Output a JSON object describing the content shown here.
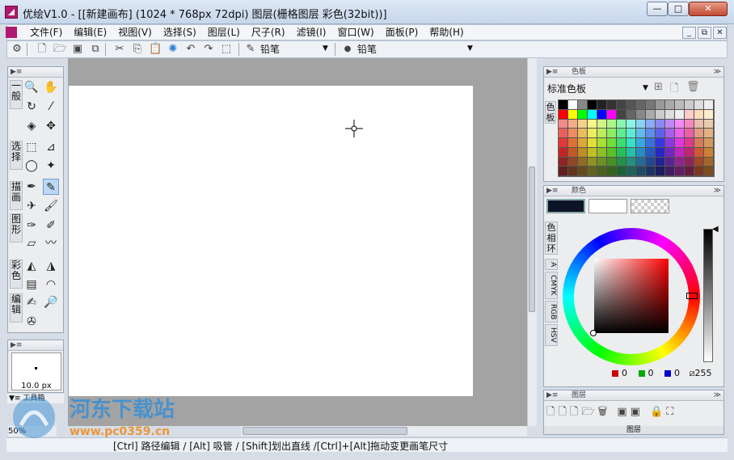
{
  "window": {
    "title": "优绘V1.0 - [[新建画布] (1024 * 768px 72dpi)    图层(栅格图层 彩色(32bit))]",
    "minimize": "—",
    "maximize": "□",
    "close": "✕"
  },
  "menu": [
    "文件(F)",
    "编辑(E)",
    "视图(V)",
    "选择(S)",
    "图层(L)",
    "尺子(R)",
    "滤镜(I)",
    "窗口(W)",
    "面板(P)",
    "帮助(H)"
  ],
  "mdi": {
    "minimize": "_",
    "restore": "⧉",
    "close": "✕"
  },
  "toolbar": {
    "tool_name": "铅笔",
    "brush_name": "铅笔"
  },
  "tool_tabs": [
    "一般",
    "选择",
    "描画",
    "图形",
    "彩色",
    "编辑"
  ],
  "brush": {
    "size": "10.0 px"
  },
  "tool_footer": "工具箱",
  "zoom": "50%",
  "swatch_panel": {
    "title": "色板",
    "preset": "标准色板",
    "tab": "色板"
  },
  "color_panel": {
    "title": "颜色",
    "tabs": [
      "色相环",
      "A",
      "CMYK",
      "RGB",
      "HSV"
    ],
    "r": "0",
    "g": "0",
    "b": "0",
    "a": "255"
  },
  "layer_panel": {
    "title": "图层",
    "footer": "图层"
  },
  "status": {
    "text": "[Ctrl] 路径编辑 / [Alt] 吸管 / [Shift]划出直线 /[Ctrl]+[Alt]拖动变更画笔尺寸"
  },
  "watermark": {
    "title": "河东下载站",
    "url": "www.pc0359.cn"
  },
  "colors": {
    "accent": "#b01970",
    "foreground": "#0e1428",
    "background": "#ffffff"
  }
}
